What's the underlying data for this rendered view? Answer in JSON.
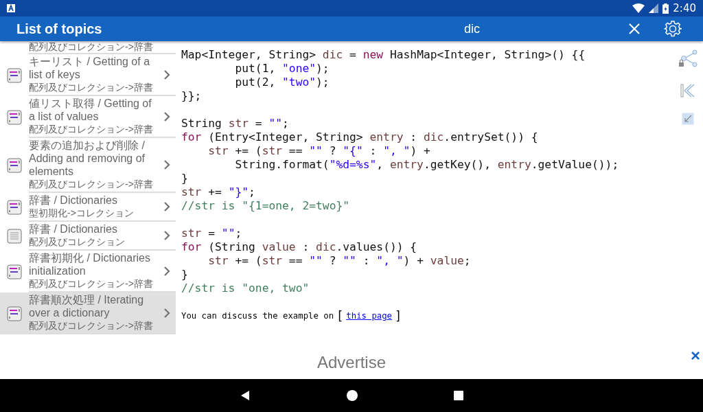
{
  "status_bar": {
    "time": "2:40"
  },
  "app_bar": {
    "title": "List of topics",
    "search_value": "dic"
  },
  "sidebar": {
    "partial_item": {
      "subtitle": "配列及びコレクション->辞書"
    },
    "items": [
      {
        "kind": "code",
        "title": "キーリスト / Getting of a list of keys",
        "subtitle": "配列及びコレクション->辞書",
        "selected": false
      },
      {
        "kind": "code",
        "title": "値リスト取得 / Getting of a list of values",
        "subtitle": "配列及びコレクション->辞書",
        "selected": false
      },
      {
        "kind": "code",
        "title": "要素の追加および削除 / Adding and removing of elements",
        "subtitle": "配列及びコレクション->辞書",
        "selected": false
      },
      {
        "kind": "code",
        "title": "辞書 / Dictionaries",
        "subtitle": "型初期化->コレクション",
        "selected": false
      },
      {
        "kind": "doc",
        "title": "辞書 / Dictionaries",
        "subtitle": "配列及びコレクション",
        "selected": false
      },
      {
        "kind": "code",
        "title": "辞書初期化 / Dictionaries initialization",
        "subtitle": "配列及びコレクション->辞書",
        "selected": false
      },
      {
        "kind": "code",
        "title": "辞書順次処理 / Iterating over a dictionary",
        "subtitle": "配列及びコレクション->辞書",
        "selected": true
      }
    ]
  },
  "code_lines": [
    {
      "kind": "code",
      "tokens": [
        {
          "kind": "plain",
          "text": "Map<Integer, String> "
        },
        {
          "kind": "var",
          "text": "dic"
        },
        {
          "kind": "plain",
          "text": " = "
        },
        {
          "kind": "keyword",
          "text": "new"
        },
        {
          "kind": "plain",
          "text": " HashMap<Integer, String>() {{"
        }
      ]
    },
    {
      "kind": "code",
      "tokens": [
        {
          "kind": "plain",
          "text": "        put(1, "
        },
        {
          "kind": "string",
          "text": "\"one\""
        },
        {
          "kind": "plain",
          "text": ");"
        }
      ]
    },
    {
      "kind": "code",
      "tokens": [
        {
          "kind": "plain",
          "text": "        put(2, "
        },
        {
          "kind": "string",
          "text": "\"two\""
        },
        {
          "kind": "plain",
          "text": ");"
        }
      ]
    },
    {
      "kind": "code",
      "tokens": [
        {
          "kind": "plain",
          "text": "}};"
        }
      ]
    },
    {
      "kind": "blank"
    },
    {
      "kind": "code",
      "tokens": [
        {
          "kind": "plain",
          "text": "String "
        },
        {
          "kind": "var",
          "text": "str"
        },
        {
          "kind": "plain",
          "text": " = "
        },
        {
          "kind": "string",
          "text": "\"\""
        },
        {
          "kind": "plain",
          "text": ";"
        }
      ]
    },
    {
      "kind": "code",
      "tokens": [
        {
          "kind": "keyword",
          "text": "for"
        },
        {
          "kind": "plain",
          "text": " (Entry<Integer, String> "
        },
        {
          "kind": "var",
          "text": "entry"
        },
        {
          "kind": "plain",
          "text": " : "
        },
        {
          "kind": "var",
          "text": "dic"
        },
        {
          "kind": "plain",
          "text": ".entrySet()) {"
        }
      ]
    },
    {
      "kind": "code",
      "tokens": [
        {
          "kind": "var",
          "text": "    str"
        },
        {
          "kind": "plain",
          "text": " += ("
        },
        {
          "kind": "var",
          "text": "str"
        },
        {
          "kind": "plain",
          "text": " == "
        },
        {
          "kind": "string",
          "text": "\"\""
        },
        {
          "kind": "plain",
          "text": " ? "
        },
        {
          "kind": "string",
          "text": "\"{\""
        },
        {
          "kind": "plain",
          "text": " : "
        },
        {
          "kind": "string",
          "text": "\", \""
        },
        {
          "kind": "plain",
          "text": ") +"
        }
      ]
    },
    {
      "kind": "code",
      "tokens": [
        {
          "kind": "plain",
          "text": "        String.format("
        },
        {
          "kind": "string",
          "text": "\"%d=%s\""
        },
        {
          "kind": "plain",
          "text": ", "
        },
        {
          "kind": "var",
          "text": "entry"
        },
        {
          "kind": "plain",
          "text": ".getKey(), "
        },
        {
          "kind": "var",
          "text": "entry"
        },
        {
          "kind": "plain",
          "text": ".getValue());"
        }
      ]
    },
    {
      "kind": "code",
      "tokens": [
        {
          "kind": "plain",
          "text": "}"
        }
      ]
    },
    {
      "kind": "code",
      "tokens": [
        {
          "kind": "var",
          "text": "str"
        },
        {
          "kind": "plain",
          "text": " += "
        },
        {
          "kind": "string",
          "text": "\"}\""
        },
        {
          "kind": "plain",
          "text": ";"
        }
      ]
    },
    {
      "kind": "code",
      "tokens": [
        {
          "kind": "comment",
          "text": "//str is \"{1=one, 2=two}\""
        }
      ]
    },
    {
      "kind": "blank"
    },
    {
      "kind": "code",
      "tokens": [
        {
          "kind": "var",
          "text": "str"
        },
        {
          "kind": "plain",
          "text": " = "
        },
        {
          "kind": "string",
          "text": "\"\""
        },
        {
          "kind": "plain",
          "text": ";"
        }
      ]
    },
    {
      "kind": "code",
      "tokens": [
        {
          "kind": "keyword",
          "text": "for"
        },
        {
          "kind": "plain",
          "text": " (String "
        },
        {
          "kind": "var",
          "text": "value"
        },
        {
          "kind": "plain",
          "text": " : "
        },
        {
          "kind": "var",
          "text": "dic"
        },
        {
          "kind": "plain",
          "text": ".values()) {"
        }
      ]
    },
    {
      "kind": "code",
      "tokens": [
        {
          "kind": "var",
          "text": "    str"
        },
        {
          "kind": "plain",
          "text": " += ("
        },
        {
          "kind": "var",
          "text": "str"
        },
        {
          "kind": "plain",
          "text": " == "
        },
        {
          "kind": "string",
          "text": "\"\""
        },
        {
          "kind": "plain",
          "text": " ? "
        },
        {
          "kind": "string",
          "text": "\"\""
        },
        {
          "kind": "plain",
          "text": " : "
        },
        {
          "kind": "string",
          "text": "\", \""
        },
        {
          "kind": "plain",
          "text": ") + "
        },
        {
          "kind": "var",
          "text": "value"
        },
        {
          "kind": "plain",
          "text": ";"
        }
      ]
    },
    {
      "kind": "code",
      "tokens": [
        {
          "kind": "plain",
          "text": "}"
        }
      ]
    },
    {
      "kind": "code",
      "tokens": [
        {
          "kind": "comment",
          "text": "//str is \"one, two\""
        }
      ]
    }
  ],
  "discussion": {
    "text": "You can discuss the example on",
    "open_bracket": "[",
    "link": "this page",
    "close_bracket": "]"
  },
  "ad": {
    "label": "Advertise",
    "close": "×"
  }
}
